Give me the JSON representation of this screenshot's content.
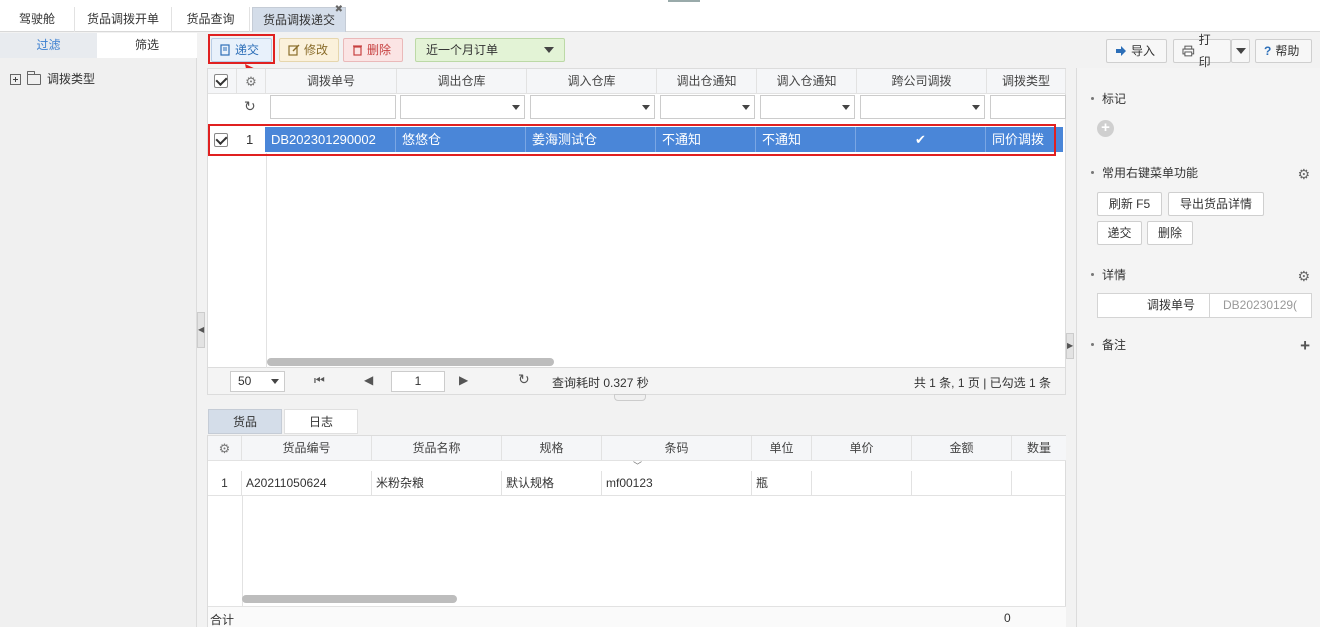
{
  "tabs": [
    {
      "label": "驾驶舱"
    },
    {
      "label": "货品调拨开单"
    },
    {
      "label": "货品查询"
    },
    {
      "label": "货品调拨递交",
      "active": true
    }
  ],
  "left": {
    "tabs": [
      "过滤",
      "筛选"
    ],
    "tree_item": "调拨类型"
  },
  "toolbar": {
    "submit": "递交",
    "edit": "修改",
    "delete": "删除",
    "period": "近一个月订单",
    "import": "导入",
    "print": "打印",
    "help": "帮助"
  },
  "grid": {
    "columns": [
      "调拨单号",
      "调出仓库",
      "调入仓库",
      "调出仓通知",
      "调入仓通知",
      "跨公司调拨",
      "调拨类型"
    ],
    "rows": [
      {
        "index": "1",
        "order_no": "DB202301290002",
        "out_wh": "悠悠仓",
        "in_wh": "姜海测试仓",
        "out_notice": "不通知",
        "in_notice": "不通知",
        "cross": "✔",
        "type": "同价调拨"
      }
    ]
  },
  "pager": {
    "page_size": "50",
    "page": "1",
    "query_time": "查询耗时 0.327 秒",
    "summary": "共 1 条, 1 页 | 已勾选 1 条"
  },
  "detail_tabs": [
    "货品",
    "日志"
  ],
  "goods": {
    "columns": [
      "货品编号",
      "货品名称",
      "规格",
      "条码",
      "单位",
      "单价",
      "金额",
      "数量"
    ],
    "rows": [
      {
        "index": "1",
        "code": "A20211050624",
        "name": "米粉杂粮",
        "spec": "默认规格",
        "barcode": "mf00123",
        "unit": "瓶",
        "price": "",
        "amount": ""
      }
    ],
    "sum_label": "合计",
    "sum_value": "0"
  },
  "right": {
    "mark": "标记",
    "menu_title": "常用右键菜单功能",
    "menu_buttons": [
      "刷新  F5",
      "导出货品详情",
      "递交",
      "删除"
    ],
    "detail_title": "详情",
    "detail_key": "调拨单号",
    "detail_value": "DB20230129(",
    "note_title": "备注"
  }
}
